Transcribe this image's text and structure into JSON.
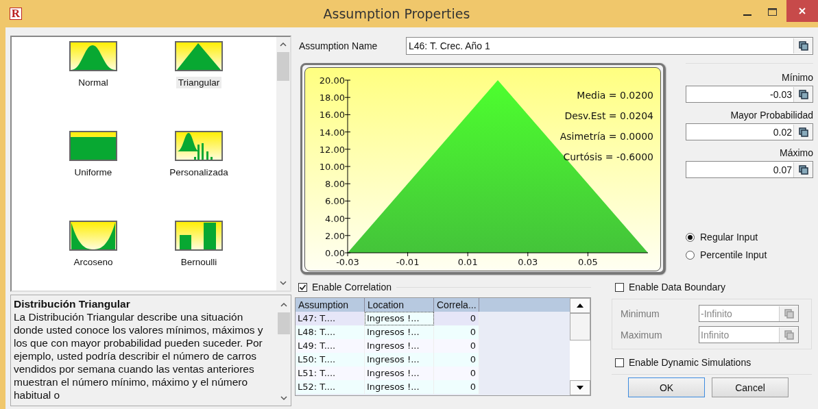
{
  "window": {
    "logo": "R",
    "title": "Assumption Properties"
  },
  "distributions": [
    {
      "name": "Normal",
      "kind": "normal",
      "selected": false
    },
    {
      "name": "Triangular",
      "kind": "triangular",
      "selected": true
    },
    {
      "name": "Uniforme",
      "kind": "uniform",
      "selected": false
    },
    {
      "name": "Personalizada",
      "kind": "custom",
      "selected": false
    },
    {
      "name": "Arcoseno",
      "kind": "arcsine",
      "selected": false
    },
    {
      "name": "Bernoulli",
      "kind": "bernoulli",
      "selected": false
    }
  ],
  "description": {
    "title": "Distribución Triangular",
    "text": "La Distribución Triangular describe una situación donde usted conoce los valores mínimos, máximos y los que con mayor probabilidad pueden suceder. Por ejemplo, usted podría describir el número de carros vendidos por semana cuando las ventas anteriores muestran el número mínimo, máximo y el número habitual o"
  },
  "assumption_name": {
    "label": "Assumption Name",
    "value": "L46: T. Crec. Año 1"
  },
  "chart_data": {
    "type": "area",
    "x": [
      -0.03,
      0.02,
      0.07
    ],
    "series": [
      {
        "color": "#44c43a",
        "values": [
          0,
          20,
          0
        ]
      }
    ],
    "xlim": [
      -0.03,
      0.07
    ],
    "ylim": [
      0,
      20
    ],
    "xticks": [
      -0.03,
      -0.01,
      0.01,
      0.03,
      0.05
    ],
    "yticks": [
      {
        "value": 0,
        "label": "0.00"
      },
      {
        "value": 2,
        "label": "2.00"
      },
      {
        "value": 4,
        "label": "4.00"
      },
      {
        "value": 6,
        "label": "6.00"
      },
      {
        "value": 8,
        "label": "8.00"
      },
      {
        "value": 10,
        "label": "10.00"
      },
      {
        "value": 12,
        "label": "12.00"
      },
      {
        "value": 14,
        "label": "14.00"
      },
      {
        "value": 16,
        "label": "16.00"
      },
      {
        "value": 18,
        "label": "18.00"
      },
      {
        "value": 20,
        "label": "20.00"
      }
    ],
    "annotations": [
      "Media = 0.0200",
      "Desv.Est = 0.0204",
      "Asimetría = 0.0000",
      "Curtósis = -0.6000"
    ]
  },
  "parameters": [
    {
      "label": "Mínimo",
      "value": "-0.03"
    },
    {
      "label": "Mayor Probabilidad",
      "value": "0.02"
    },
    {
      "label": "Máximo",
      "value": "0.07"
    }
  ],
  "input_modes": [
    {
      "label": "Regular Input",
      "selected": true
    },
    {
      "label": "Percentile Input",
      "selected": false
    }
  ],
  "correlation": {
    "label": "Enable Correlation",
    "checked": true,
    "columns": [
      "Assumption",
      "Location",
      "Correla..."
    ],
    "rows": [
      {
        "cells": [
          "L47: T....",
          "Ingresos !...",
          "0"
        ],
        "selected": true
      },
      {
        "cells": [
          "L48: T....",
          "Ingresos !...",
          "0"
        ],
        "selected": false
      },
      {
        "cells": [
          "L49: T....",
          "Ingresos !...",
          "0"
        ],
        "selected": false
      },
      {
        "cells": [
          "L50: T....",
          "Ingresos !...",
          "0"
        ],
        "selected": false
      },
      {
        "cells": [
          "L51: T....",
          "Ingresos !...",
          "0"
        ],
        "selected": false
      },
      {
        "cells": [
          "L52: T....",
          "Ingresos !...",
          "0"
        ],
        "selected": false
      }
    ]
  },
  "data_boundary": {
    "label": "Enable Data Boundary",
    "checked": false,
    "disabled": true,
    "fields": [
      {
        "label": "Minimum",
        "value": "-Infinito"
      },
      {
        "label": "Maximum",
        "value": "Infinito"
      }
    ]
  },
  "dynamic_simulations": {
    "label": "Enable Dynamic Simulations",
    "checked": false
  },
  "buttons": [
    {
      "label": "OK",
      "default": true
    },
    {
      "label": "Cancel",
      "default": false
    }
  ]
}
